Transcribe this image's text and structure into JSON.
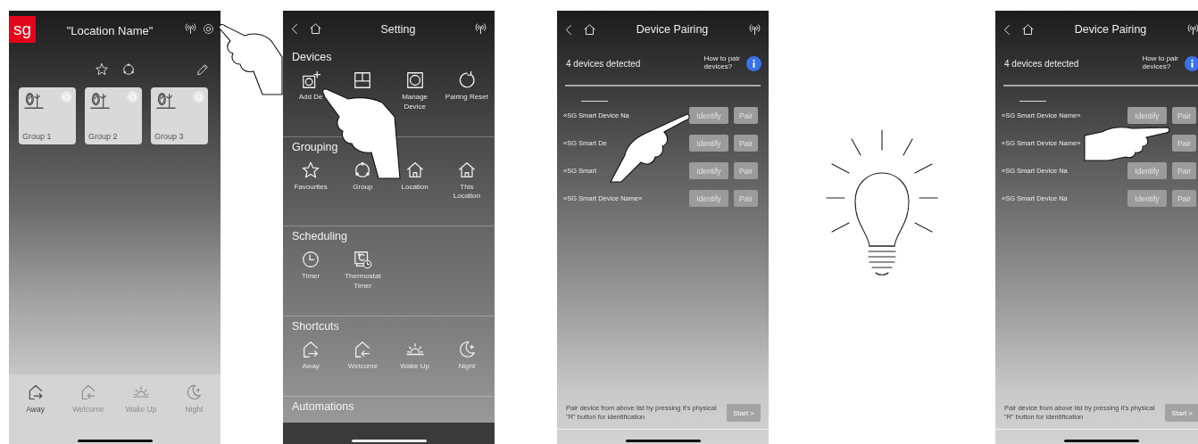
{
  "screens": [
    {
      "kind": "home",
      "logo": "sg",
      "title": "\"Location Name\"",
      "groups": [
        {
          "label": "Group 1"
        },
        {
          "label": "Group 2"
        },
        {
          "label": "Group 3"
        }
      ],
      "shortcuts": [
        {
          "kind": "away",
          "label": "Away",
          "selected": true
        },
        {
          "kind": "welcome",
          "label": "Welcome",
          "selected": false
        },
        {
          "kind": "wakeup",
          "label": "Wake Up",
          "selected": false
        },
        {
          "kind": "night",
          "label": "Night",
          "selected": false
        }
      ]
    },
    {
      "kind": "settings",
      "title": "Setting",
      "sections": [
        {
          "title": "Devices",
          "items": [
            {
              "kind": "add",
              "label": "Add De"
            },
            {
              "kind": "panel"
            },
            {
              "kind": "manage",
              "label": "Manage\nDevice"
            },
            {
              "kind": "reset",
              "label": "Pairing Reset"
            }
          ]
        },
        {
          "title": "Grouping",
          "items": [
            {
              "kind": "star",
              "label": "Favourites"
            },
            {
              "kind": "ring",
              "label": "Group"
            },
            {
              "kind": "location",
              "label": "Location"
            },
            {
              "kind": "location",
              "label": "This\nLocation"
            }
          ]
        },
        {
          "title": "Scheduling",
          "items": [
            {
              "kind": "timer",
              "label": "Timer"
            },
            {
              "kind": "thermostat",
              "label": "Thermostat\nTimer"
            }
          ]
        },
        {
          "title": "Shortcuts",
          "items": [
            {
              "kind": "away",
              "label": "Away"
            },
            {
              "kind": "welcome",
              "label": "Welcome"
            },
            {
              "kind": "wakeup",
              "label": "Wake Up"
            },
            {
              "kind": "night",
              "label": "Night"
            }
          ]
        },
        {
          "title": "Automations"
        }
      ]
    },
    {
      "kind": "pairing",
      "title": "Device Pairing",
      "count": "4 devices detected",
      "help": "How to pair\ndevices?",
      "rows": [
        {
          "name": "«SG Smart Device Na",
          "identify": "Identify",
          "pair": "Pair"
        },
        {
          "name": "«SG Smart De",
          "identify": "Identify",
          "pair": "Pair"
        },
        {
          "name": "«SG Smart",
          "identify": "Identify",
          "pair": "Pair"
        },
        {
          "name": "«SG Smart Device Name»",
          "identify": "Identify",
          "pair": "Pair"
        }
      ],
      "hint": "Pair device from above list by pressing it's physical \"R\" button for identification",
      "start": "Start >"
    },
    {
      "kind": "bulb"
    },
    {
      "kind": "pairing",
      "title": "Device Pairing",
      "count": "4 devices detected",
      "help": "How to pair\ndevices?",
      "rows": [
        {
          "name": "«SG Smart Device Name»",
          "identify": "Identify",
          "pair": "Pair"
        },
        {
          "name": "«SG Smart Device Name»",
          "pair": "Pair"
        },
        {
          "name": "«SG Smart Device Na",
          "identify": "Identify",
          "pair": "Pair"
        },
        {
          "name": "«SG Smart Device Na",
          "identify": "Identify",
          "pair": "Pair"
        }
      ],
      "hint": "Pair device from above list by pressing it's physical \"R\" button for identification",
      "start": "Start >"
    }
  ]
}
